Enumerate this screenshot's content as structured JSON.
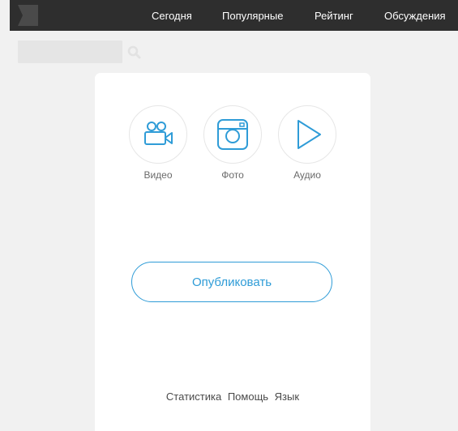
{
  "header": {
    "nav": [
      {
        "label": "Сегодня"
      },
      {
        "label": "Популярные"
      },
      {
        "label": "Рейтинг"
      },
      {
        "label": "Обсуждения"
      }
    ]
  },
  "search": {
    "placeholder": "",
    "value": ""
  },
  "media": [
    {
      "label": "Видео",
      "icon": "video-camera-icon"
    },
    {
      "label": "Фото",
      "icon": "instagram-camera-icon"
    },
    {
      "label": "Аудио",
      "icon": "play-icon"
    }
  ],
  "publish": {
    "label": "Опубликовать"
  },
  "footer": {
    "links": [
      "Статистика",
      "Помощь",
      "Язык"
    ]
  },
  "colors": {
    "accent": "#2f9cd7",
    "topbar": "#2e2e2e",
    "background": "#f1f1f1"
  }
}
